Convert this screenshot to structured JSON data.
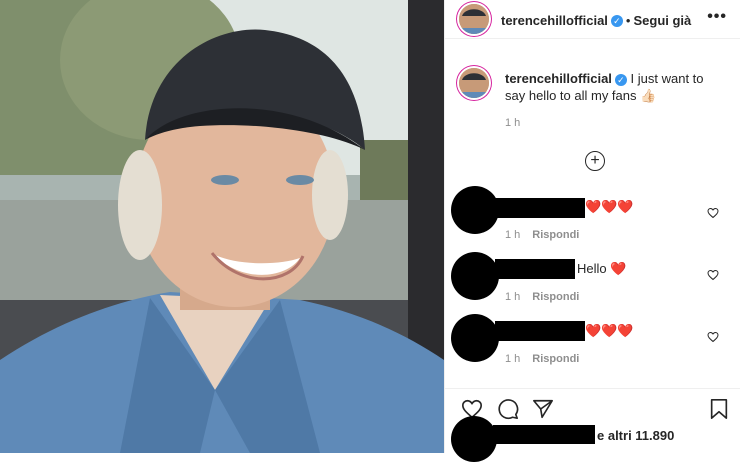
{
  "post": {
    "username": "terencehillofficial",
    "verified": "✓",
    "separator": "•",
    "follow_label": "Segui già",
    "more_label": "•••",
    "caption_text": "I just want to say hello to all my fans 👍🏻",
    "caption_time": "1 h"
  },
  "comments": [
    {
      "text": "❤️❤️❤️",
      "time": "1 h",
      "reply_label": "Rispondi"
    },
    {
      "text": "Hello ❤️",
      "time": "1 h",
      "reply_label": "Rispondi"
    },
    {
      "text": "❤️❤️❤️",
      "time": "1 h",
      "reply_label": "Rispondi"
    }
  ],
  "likes": {
    "text": "e altri 11.890"
  },
  "icons": {
    "add": "add-comments-icon",
    "like": "heart-outline-icon",
    "comment": "speech-bubble-icon",
    "share": "paper-plane-icon",
    "save": "bookmark-icon"
  },
  "colors": {
    "accent": "#3897f0",
    "heart": "#e0102a",
    "muted": "#8e8e8e"
  }
}
